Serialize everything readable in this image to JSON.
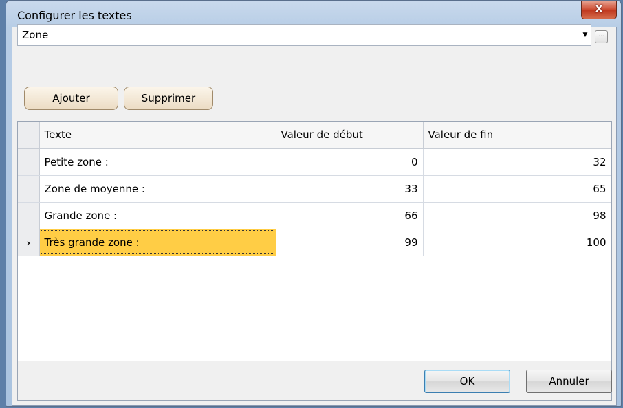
{
  "window": {
    "title": "Configurer les textes",
    "close_glyph": "X"
  },
  "combo": {
    "value": "Zone",
    "arrow_glyph": "▼",
    "ellipsis_label": "..."
  },
  "toolbar": {
    "add_label": "Ajouter",
    "delete_label": "Supprimer"
  },
  "grid": {
    "columns": [
      "Texte",
      "Valeur de début",
      "Valeur de fin"
    ],
    "current_row_glyph": "›",
    "rows": [
      {
        "text": "Petite zone :",
        "start": "0",
        "end": "32"
      },
      {
        "text": "Zone de moyenne :",
        "start": "33",
        "end": "65"
      },
      {
        "text": "Grande zone :",
        "start": "66",
        "end": "98"
      },
      {
        "text": "Très grande zone :",
        "start": "99",
        "end": "100"
      }
    ]
  },
  "footer": {
    "ok_label": "OK",
    "cancel_label": "Annuler"
  },
  "colors": {
    "selected_cell": "#ffcd45",
    "close_button": "#c0391f"
  }
}
